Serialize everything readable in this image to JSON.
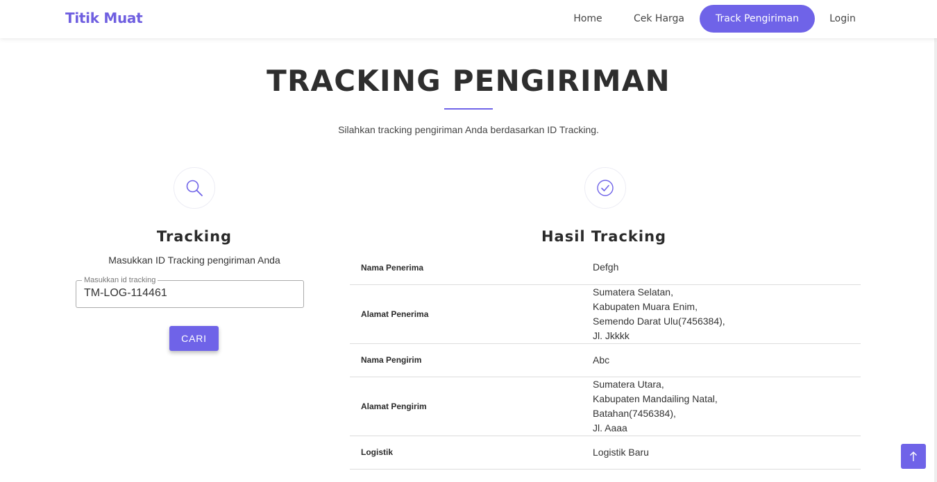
{
  "nav": {
    "brand": "Titik Muat",
    "items": [
      {
        "label": "Home"
      },
      {
        "label": "Cek Harga"
      },
      {
        "label": "Track Pengiriman"
      },
      {
        "label": "Login"
      }
    ],
    "active": "Track Pengiriman"
  },
  "hero": {
    "title": "TRACKING PENGIRIMAN",
    "subtitle": "Silahkan tracking pengiriman Anda berdasarkan ID Tracking."
  },
  "tracking": {
    "icon": "search-icon",
    "title": "Tracking",
    "instruction": "Masukkan ID Tracking pengiriman Anda",
    "field_label": "Masukkan id tracking",
    "field_value": "TM-LOG-114461",
    "button_label": "CARI"
  },
  "result": {
    "icon": "check-circle-icon",
    "title": "Hasil Tracking",
    "rows": [
      {
        "label": "Nama Penerima",
        "lines": [
          "Defgh"
        ]
      },
      {
        "label": "Alamat Penerima",
        "lines": [
          "Sumatera Selatan,",
          "Kabupaten Muara Enim,",
          "Semendo Darat Ulu(7456384),",
          "Jl. Jkkkk"
        ]
      },
      {
        "label": "Nama Pengirim",
        "lines": [
          "Abc"
        ]
      },
      {
        "label": "Alamat Pengirim",
        "lines": [
          "Sumatera Utara,",
          "Kabupaten Mandailing Natal,",
          "Batahan(7456384),",
          "Jl. Aaaa"
        ]
      },
      {
        "label": "Logistik",
        "lines": [
          "Logistik Baru"
        ]
      }
    ]
  },
  "colors": {
    "accent": "#6f63e8",
    "brand": "#6f5fe0",
    "heading": "#2e2e2e"
  },
  "back_to_top_icon": "arrow-up-icon"
}
